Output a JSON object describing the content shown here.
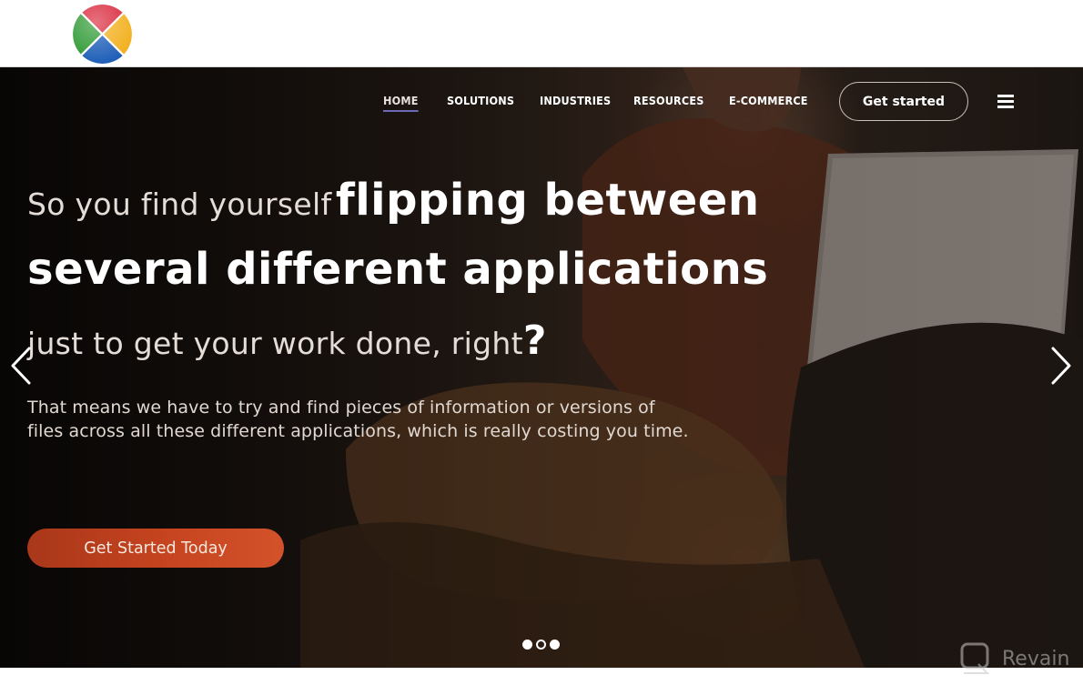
{
  "logo": {
    "icon": "four-color-x-circle-logo",
    "colors": [
      "#d9263a",
      "#f2b01e",
      "#1f5fb8",
      "#2f9a34"
    ]
  },
  "nav": {
    "items": [
      {
        "label": "HOME",
        "active": true
      },
      {
        "label": "SOLUTIONS",
        "active": false
      },
      {
        "label": "INDUSTRIES",
        "active": false
      },
      {
        "label": "RESOURCES",
        "active": false
      },
      {
        "label": "E-COMMERCE",
        "active": false
      }
    ],
    "cta_label": "Get started",
    "menu_icon": "hamburger-menu-icon"
  },
  "hero": {
    "headline_light_1": "So you find yourself",
    "headline_bold_1": "flipping between",
    "headline_bold_2": "several different applications",
    "headline_light_2": "just to get your work done, right",
    "headline_mark": "?",
    "subtext_line1": "That means we have to try and find pieces of information or versions of",
    "subtext_line2": "files across all these different applications, which is really costing you time.",
    "cta_label": "Get Started Today",
    "cta_color": "#c6441f",
    "prev_icon": "chevron-left-icon",
    "next_icon": "chevron-right-icon",
    "slides": {
      "count": 3,
      "active_index": 1
    }
  },
  "watermark": {
    "text": "Revain",
    "icon": "revain-logo-icon"
  }
}
